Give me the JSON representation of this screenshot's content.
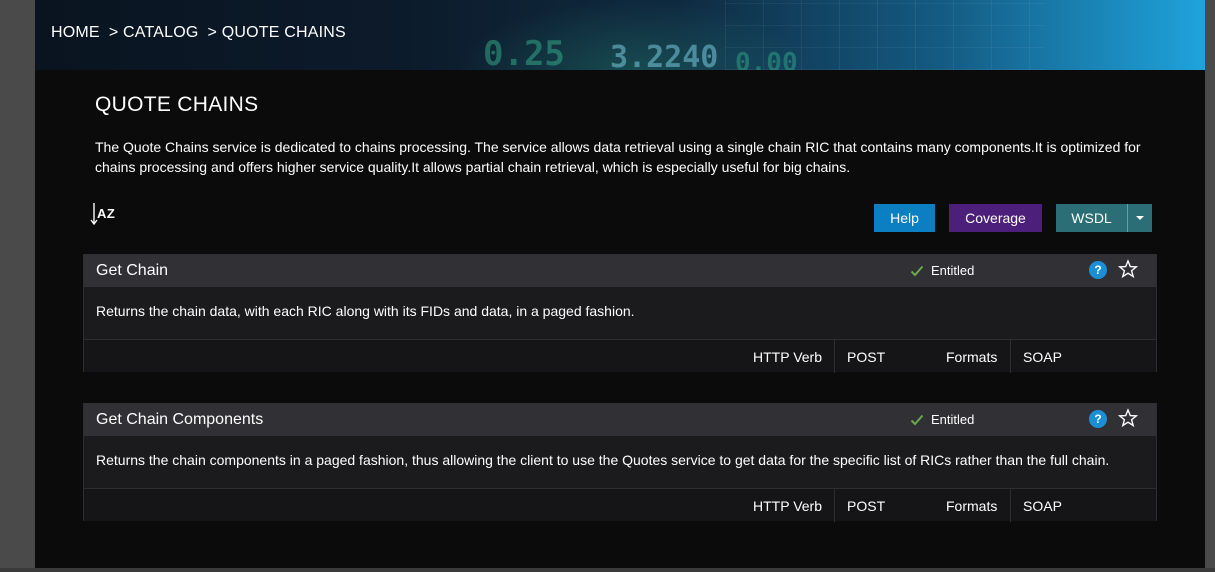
{
  "breadcrumb": [
    {
      "label": "HOME"
    },
    {
      "label": "> CATALOG"
    },
    {
      "label": "> QUOTE CHAINS"
    }
  ],
  "page": {
    "title": "QUOTE CHAINS",
    "description": "The Quote Chains service is dedicated to chains processing. The service allows data retrieval using a single chain RIC that contains many components.It is optimized for chains processing and offers higher service quality.It allows partial chain retrieval, which is especially useful for big chains."
  },
  "sort": {
    "label": "AZ"
  },
  "toolbar": {
    "help_label": "Help",
    "coverage_label": "Coverage",
    "wsdl_label": "WSDL"
  },
  "cards": [
    {
      "title": "Get Chain",
      "status": "Entitled",
      "description": "Returns the chain data, with each RIC along with its FIDs and data, in a paged fashion.",
      "http_verb_label": "HTTP Verb",
      "http_verb": "POST",
      "formats_label": "Formats",
      "formats": "SOAP"
    },
    {
      "title": "Get Chain Components",
      "status": "Entitled",
      "description": "Returns the chain components in a paged fashion, thus allowing the client to use the Quotes service to get data for the specific list of RICs rather than the full chain.",
      "http_verb_label": "HTTP Verb",
      "http_verb": "POST",
      "formats_label": "Formats",
      "formats": "SOAP"
    }
  ],
  "banner_numbers": [
    "0.25",
    "3.2240",
    "0.00"
  ],
  "colors": {
    "help": "#0c7ec2",
    "coverage": "#4c1f7a",
    "wsdl": "#2c6e75",
    "entitled_check": "#6aa84f"
  }
}
